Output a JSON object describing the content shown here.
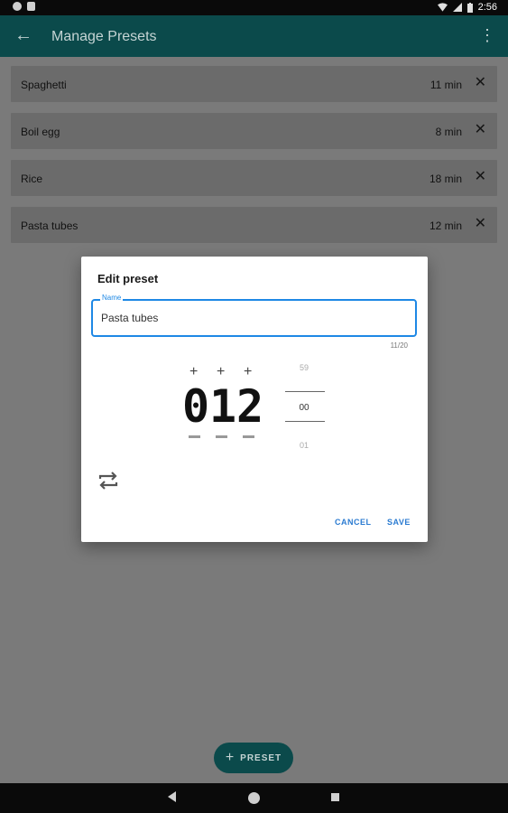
{
  "status_bar": {
    "time": "2:56"
  },
  "app_bar": {
    "title": "Manage Presets"
  },
  "presets": [
    {
      "name": "Spaghetti",
      "duration": "11 min"
    },
    {
      "name": "Boil egg",
      "duration": "8 min"
    },
    {
      "name": "Rice",
      "duration": "18 min"
    },
    {
      "name": "Pasta tubes",
      "duration": "12 min"
    }
  ],
  "dialog": {
    "title": "Edit preset",
    "name_label": "Name",
    "name_value": "Pasta tubes",
    "char_counter": "11/20",
    "digits": [
      "0",
      "1",
      "2"
    ],
    "picker": {
      "above": "59",
      "current": "00",
      "below": "01"
    },
    "cancel_label": "CANCEL",
    "save_label": "SAVE"
  },
  "fab": {
    "label": "PRESET"
  },
  "colors": {
    "primary": "#0b4a4b",
    "accent": "#1e88e5",
    "button_text": "#2b7bd1"
  }
}
